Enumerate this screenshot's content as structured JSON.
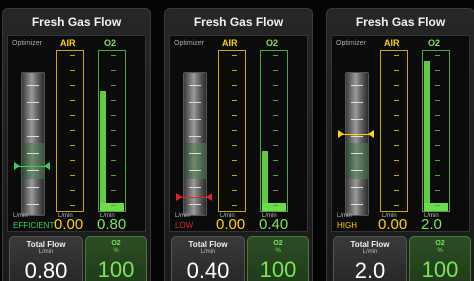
{
  "colors": {
    "air": "#ffd500",
    "o2": "#7de45a",
    "efficient": "#2fd457",
    "low": "#e0202a",
    "high": "#ffd500"
  },
  "panels": [
    {
      "title": "Fresh Gas Flow",
      "optimizer_label": "Optimizer",
      "air_label": "AIR",
      "o2_label": "O2",
      "optimizer_status": "EFFICIENT",
      "optimizer_status_color": "efficient",
      "optimizer_unit": "L/min",
      "optimizer_level": 0.66,
      "air_unit": "L/min",
      "air_value": "0.00",
      "air_fraction": 0.0,
      "o2_unit": "L/min",
      "o2_value": "0.80",
      "o2_fraction": 0.8,
      "total_flow_label": "Total Flow",
      "total_flow_unit": "L/min",
      "total_flow_value": "0.80",
      "o2_percent_label": "O2",
      "o2_percent_unit": "%",
      "o2_percent_value": "100"
    },
    {
      "title": "Fresh Gas Flow",
      "optimizer_label": "Optimizer",
      "air_label": "AIR",
      "o2_label": "O2",
      "optimizer_status": "LOW",
      "optimizer_status_color": "low",
      "optimizer_unit": "L/min",
      "optimizer_level": 0.88,
      "air_unit": "L/min",
      "air_value": "0.00",
      "air_fraction": 0.0,
      "o2_unit": "L/min",
      "o2_value": "0.40",
      "o2_fraction": 0.4,
      "total_flow_label": "Total Flow",
      "total_flow_unit": "L/min",
      "total_flow_value": "0.40",
      "o2_percent_label": "O2",
      "o2_percent_unit": "%",
      "o2_percent_value": "100"
    },
    {
      "title": "Fresh Gas Flow",
      "optimizer_label": "Optimizer",
      "air_label": "AIR",
      "o2_label": "O2",
      "optimizer_status": "HIGH",
      "optimizer_status_color": "high",
      "optimizer_unit": "L/min",
      "optimizer_level": 0.44,
      "air_unit": "L/min",
      "air_value": "0.00",
      "air_fraction": 0.0,
      "o2_unit": "L/min",
      "o2_value": "2.0",
      "o2_fraction": 1.0,
      "total_flow_label": "Total Flow",
      "total_flow_unit": "L/min",
      "total_flow_value": "2.0",
      "o2_percent_label": "O2",
      "o2_percent_unit": "%",
      "o2_percent_value": "100"
    }
  ]
}
